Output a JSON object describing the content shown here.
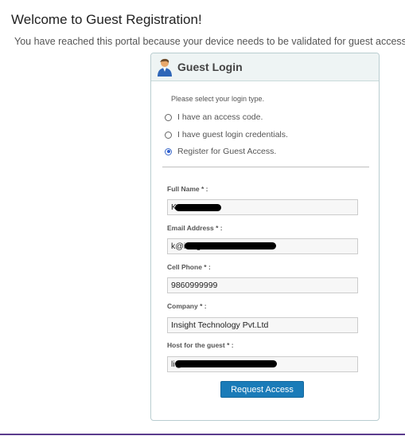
{
  "page": {
    "title": "Welcome to Guest Registration!",
    "subtitle": "You have reached this portal because your device needs to be validated for guest access."
  },
  "panel": {
    "title": "Guest Login",
    "icon": "person-icon",
    "prompt": "Please select your login type.",
    "options": [
      {
        "label": "I have an access code.",
        "checked": false
      },
      {
        "label": "I have guest login credentials.",
        "checked": false
      },
      {
        "label": "Register for Guest Access.",
        "checked": true
      }
    ]
  },
  "form": {
    "full_name": {
      "label": "Full Name * :",
      "value": "Kum"
    },
    "email": {
      "label": "Email Address * :",
      "value": "k@insightcontrol.com"
    },
    "cell_phone": {
      "label": "Cell Phone * :",
      "value": "9860999999"
    },
    "company": {
      "label": "Company * :",
      "value": "Insight Technology Pvt.Ltd"
    },
    "host": {
      "label": "Host for the guest * :",
      "value": "li@.com"
    },
    "submit_label": "Request Access"
  },
  "colors": {
    "button": "#1a7bb8",
    "header_bg": "#eef4f4",
    "border": "#b9cdd0"
  }
}
